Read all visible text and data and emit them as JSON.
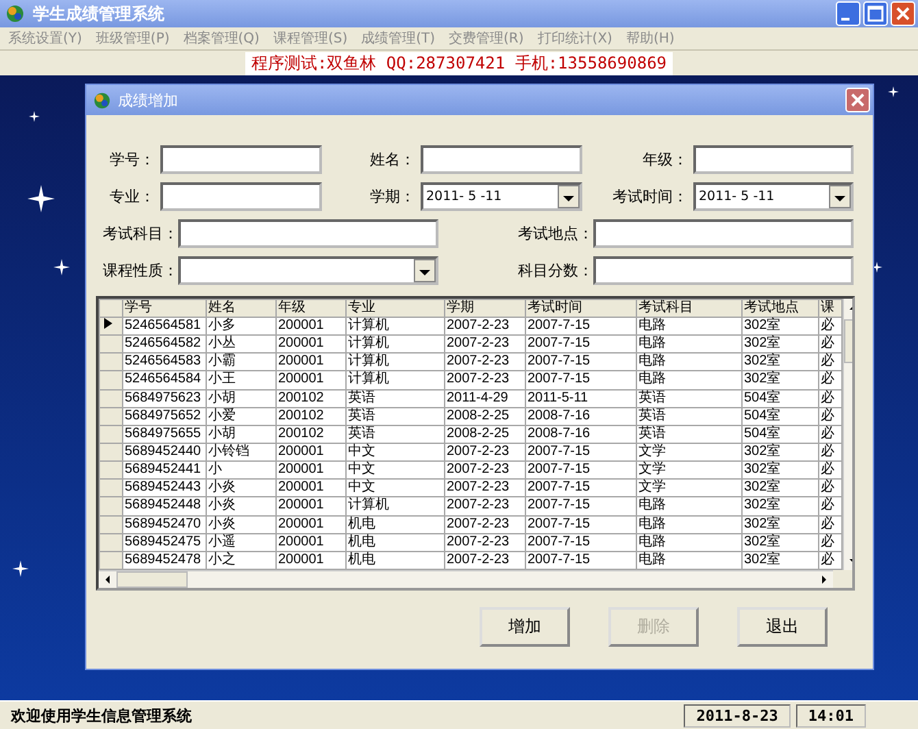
{
  "window": {
    "title": "学生成绩管理系统"
  },
  "menu": [
    "系统设置(Y)",
    "班级管理(P)",
    "档案管理(Q)",
    "课程管理(S)",
    "成绩管理(T)",
    "交费管理(R)",
    "打印统计(X)",
    "帮助(H)"
  ],
  "banner": "程序测试:双鱼林 QQ:287307421 手机:13558690869",
  "dialog": {
    "title": "成绩增加",
    "form_rows": [
      [
        {
          "kind": "text",
          "label": "学号："
        },
        {
          "kind": "text",
          "label": "姓名："
        },
        {
          "kind": "text",
          "label": "年级："
        }
      ],
      [
        {
          "kind": "text",
          "label": "专业："
        },
        {
          "kind": "combo",
          "label": "学期：",
          "value": "2011- 5 -11"
        },
        {
          "kind": "combo",
          "label": "考试时间：",
          "value": "2011- 5 -11"
        }
      ],
      [
        {
          "kind": "text",
          "label": "考试科目："
        },
        {
          "kind": "text",
          "label": "考试地点："
        }
      ],
      [
        {
          "kind": "combo",
          "label": "课程性质："
        },
        {
          "kind": "text",
          "label": "科目分数："
        }
      ]
    ],
    "table": {
      "columns": [
        "学号",
        "姓名",
        "年级",
        "专业",
        "学期",
        "考试时间",
        "考试科目",
        "考试地点",
        "课"
      ],
      "rows": [
        {
          "selected": true,
          "cells": [
            "5246564581",
            "小多",
            "200001",
            "计算机",
            "2007-2-23",
            "2007-7-15",
            "电路",
            "302室",
            "必"
          ]
        },
        {
          "selected": false,
          "cells": [
            "5246564582",
            "小丛",
            "200001",
            "计算机",
            "2007-2-23",
            "2007-7-15",
            "电路",
            "302室",
            "必"
          ]
        },
        {
          "selected": false,
          "cells": [
            "5246564583",
            "小霸",
            "200001",
            "计算机",
            "2007-2-23",
            "2007-7-15",
            "电路",
            "302室",
            "必"
          ]
        },
        {
          "selected": false,
          "cells": [
            "5246564584",
            "小王",
            "200001",
            "计算机",
            "2007-2-23",
            "2007-7-15",
            "电路",
            "302室",
            "必"
          ]
        },
        {
          "selected": false,
          "cells": [
            "5684975623",
            "小胡",
            "200102",
            "英语",
            "2011-4-29",
            "2011-5-11",
            "英语",
            "504室",
            "必"
          ]
        },
        {
          "selected": false,
          "cells": [
            "5684975652",
            "小爱",
            "200102",
            "英语",
            "2008-2-25",
            "2008-7-16",
            "英语",
            "504室",
            "必"
          ]
        },
        {
          "selected": false,
          "cells": [
            "5684975655",
            "小胡",
            "200102",
            "英语",
            "2008-2-25",
            "2008-7-16",
            "英语",
            "504室",
            "必"
          ]
        },
        {
          "selected": false,
          "cells": [
            "5689452440",
            "小铃铛",
            "200001",
            "中文",
            "2007-2-23",
            "2007-7-15",
            "文学",
            "302室",
            "必"
          ]
        },
        {
          "selected": false,
          "cells": [
            "5689452441",
            "小",
            "200001",
            "中文",
            "2007-2-23",
            "2007-7-15",
            "文学",
            "302室",
            "必"
          ]
        },
        {
          "selected": false,
          "cells": [
            "5689452443",
            "小炎",
            "200001",
            "中文",
            "2007-2-23",
            "2007-7-15",
            "文学",
            "302室",
            "必"
          ]
        },
        {
          "selected": false,
          "cells": [
            "5689452448",
            "小炎",
            "200001",
            "计算机",
            "2007-2-23",
            "2007-7-15",
            "电路",
            "302室",
            "必"
          ]
        },
        {
          "selected": false,
          "cells": [
            "5689452470",
            "小炎",
            "200001",
            "机电",
            "2007-2-23",
            "2007-7-15",
            "电路",
            "302室",
            "必"
          ]
        },
        {
          "selected": false,
          "cells": [
            "5689452475",
            "小遥",
            "200001",
            "机电",
            "2007-2-23",
            "2007-7-15",
            "电路",
            "302室",
            "必"
          ]
        },
        {
          "selected": false,
          "cells": [
            "5689452478",
            "小之",
            "200001",
            "机电",
            "2007-2-23",
            "2007-7-15",
            "电路",
            "302室",
            "必"
          ]
        }
      ]
    },
    "buttons": [
      {
        "label": "增加",
        "disabled": false
      },
      {
        "label": "删除",
        "disabled": true
      },
      {
        "label": "退出",
        "disabled": false
      }
    ]
  },
  "status_bar": {
    "message": "欢迎使用学生信息管理系统",
    "date": "2011-8-23",
    "time": "14:01"
  }
}
